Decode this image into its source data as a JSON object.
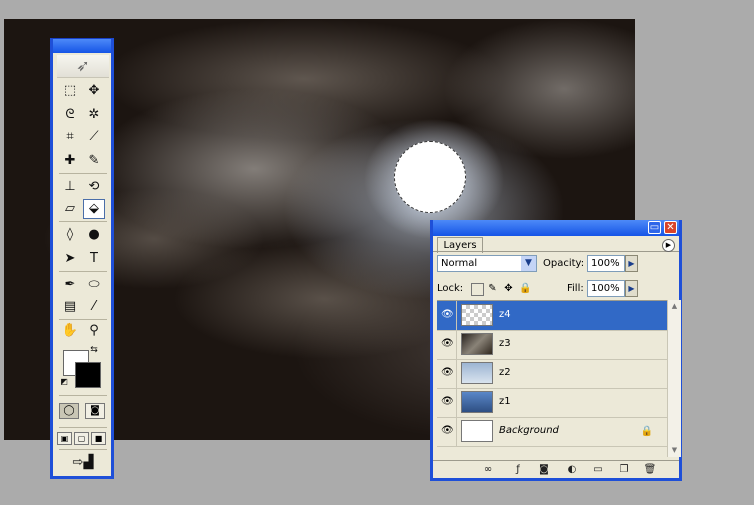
{
  "colors": {
    "titlebar_blue": "#1554e6",
    "selected_row": "#3169c6",
    "panel_bg": "#ece9d8",
    "workspace_gray": "#ababab"
  },
  "toolbox": {
    "tools": [
      {
        "name": "rectangular-marquee-icon",
        "glyph": "⬚"
      },
      {
        "name": "move-icon",
        "glyph": "✥"
      },
      {
        "name": "lasso-icon",
        "glyph": "ᘓ"
      },
      {
        "name": "magic-wand-icon",
        "glyph": "✲"
      },
      {
        "name": "crop-icon",
        "glyph": "⌗"
      },
      {
        "name": "slice-icon",
        "glyph": "⟋"
      },
      {
        "name": "healing-brush-icon",
        "glyph": "✚"
      },
      {
        "name": "brush-icon",
        "glyph": "✎"
      },
      {
        "name": "clone-stamp-icon",
        "glyph": "⊥"
      },
      {
        "name": "history-brush-icon",
        "glyph": "⟲"
      },
      {
        "name": "eraser-icon",
        "glyph": "▱"
      },
      {
        "name": "paint-bucket-icon",
        "glyph": "⬙"
      },
      {
        "name": "blur-icon",
        "glyph": "◊"
      },
      {
        "name": "dodge-icon",
        "glyph": "●"
      },
      {
        "name": "path-selection-icon",
        "glyph": "➤"
      },
      {
        "name": "type-icon",
        "glyph": "T"
      },
      {
        "name": "pen-icon",
        "glyph": "✒"
      },
      {
        "name": "ellipse-shape-icon",
        "glyph": "⬭"
      },
      {
        "name": "notes-icon",
        "glyph": "▤"
      },
      {
        "name": "eyedropper-icon",
        "glyph": "⁄"
      },
      {
        "name": "hand-icon",
        "glyph": "✋"
      },
      {
        "name": "zoom-icon",
        "glyph": "⚲"
      }
    ]
  },
  "layers_panel": {
    "tab_label": "Layers",
    "blend_mode": "Normal",
    "opacity_label": "Opacity:",
    "opacity_value": "100%",
    "lock_label": "Lock:",
    "fill_label": "Fill:",
    "fill_value": "100%",
    "layers": [
      {
        "name": "z4",
        "thumb": "checker",
        "selected": true,
        "locked": false,
        "italic": false
      },
      {
        "name": "z3",
        "thumb": "t-z3",
        "selected": false,
        "locked": false,
        "italic": false
      },
      {
        "name": "z2",
        "thumb": "t-z2",
        "selected": false,
        "locked": false,
        "italic": false
      },
      {
        "name": "z1",
        "thumb": "t-z1",
        "selected": false,
        "locked": false,
        "italic": false
      },
      {
        "name": "Background",
        "thumb": "white",
        "selected": false,
        "locked": true,
        "italic": true
      }
    ]
  }
}
